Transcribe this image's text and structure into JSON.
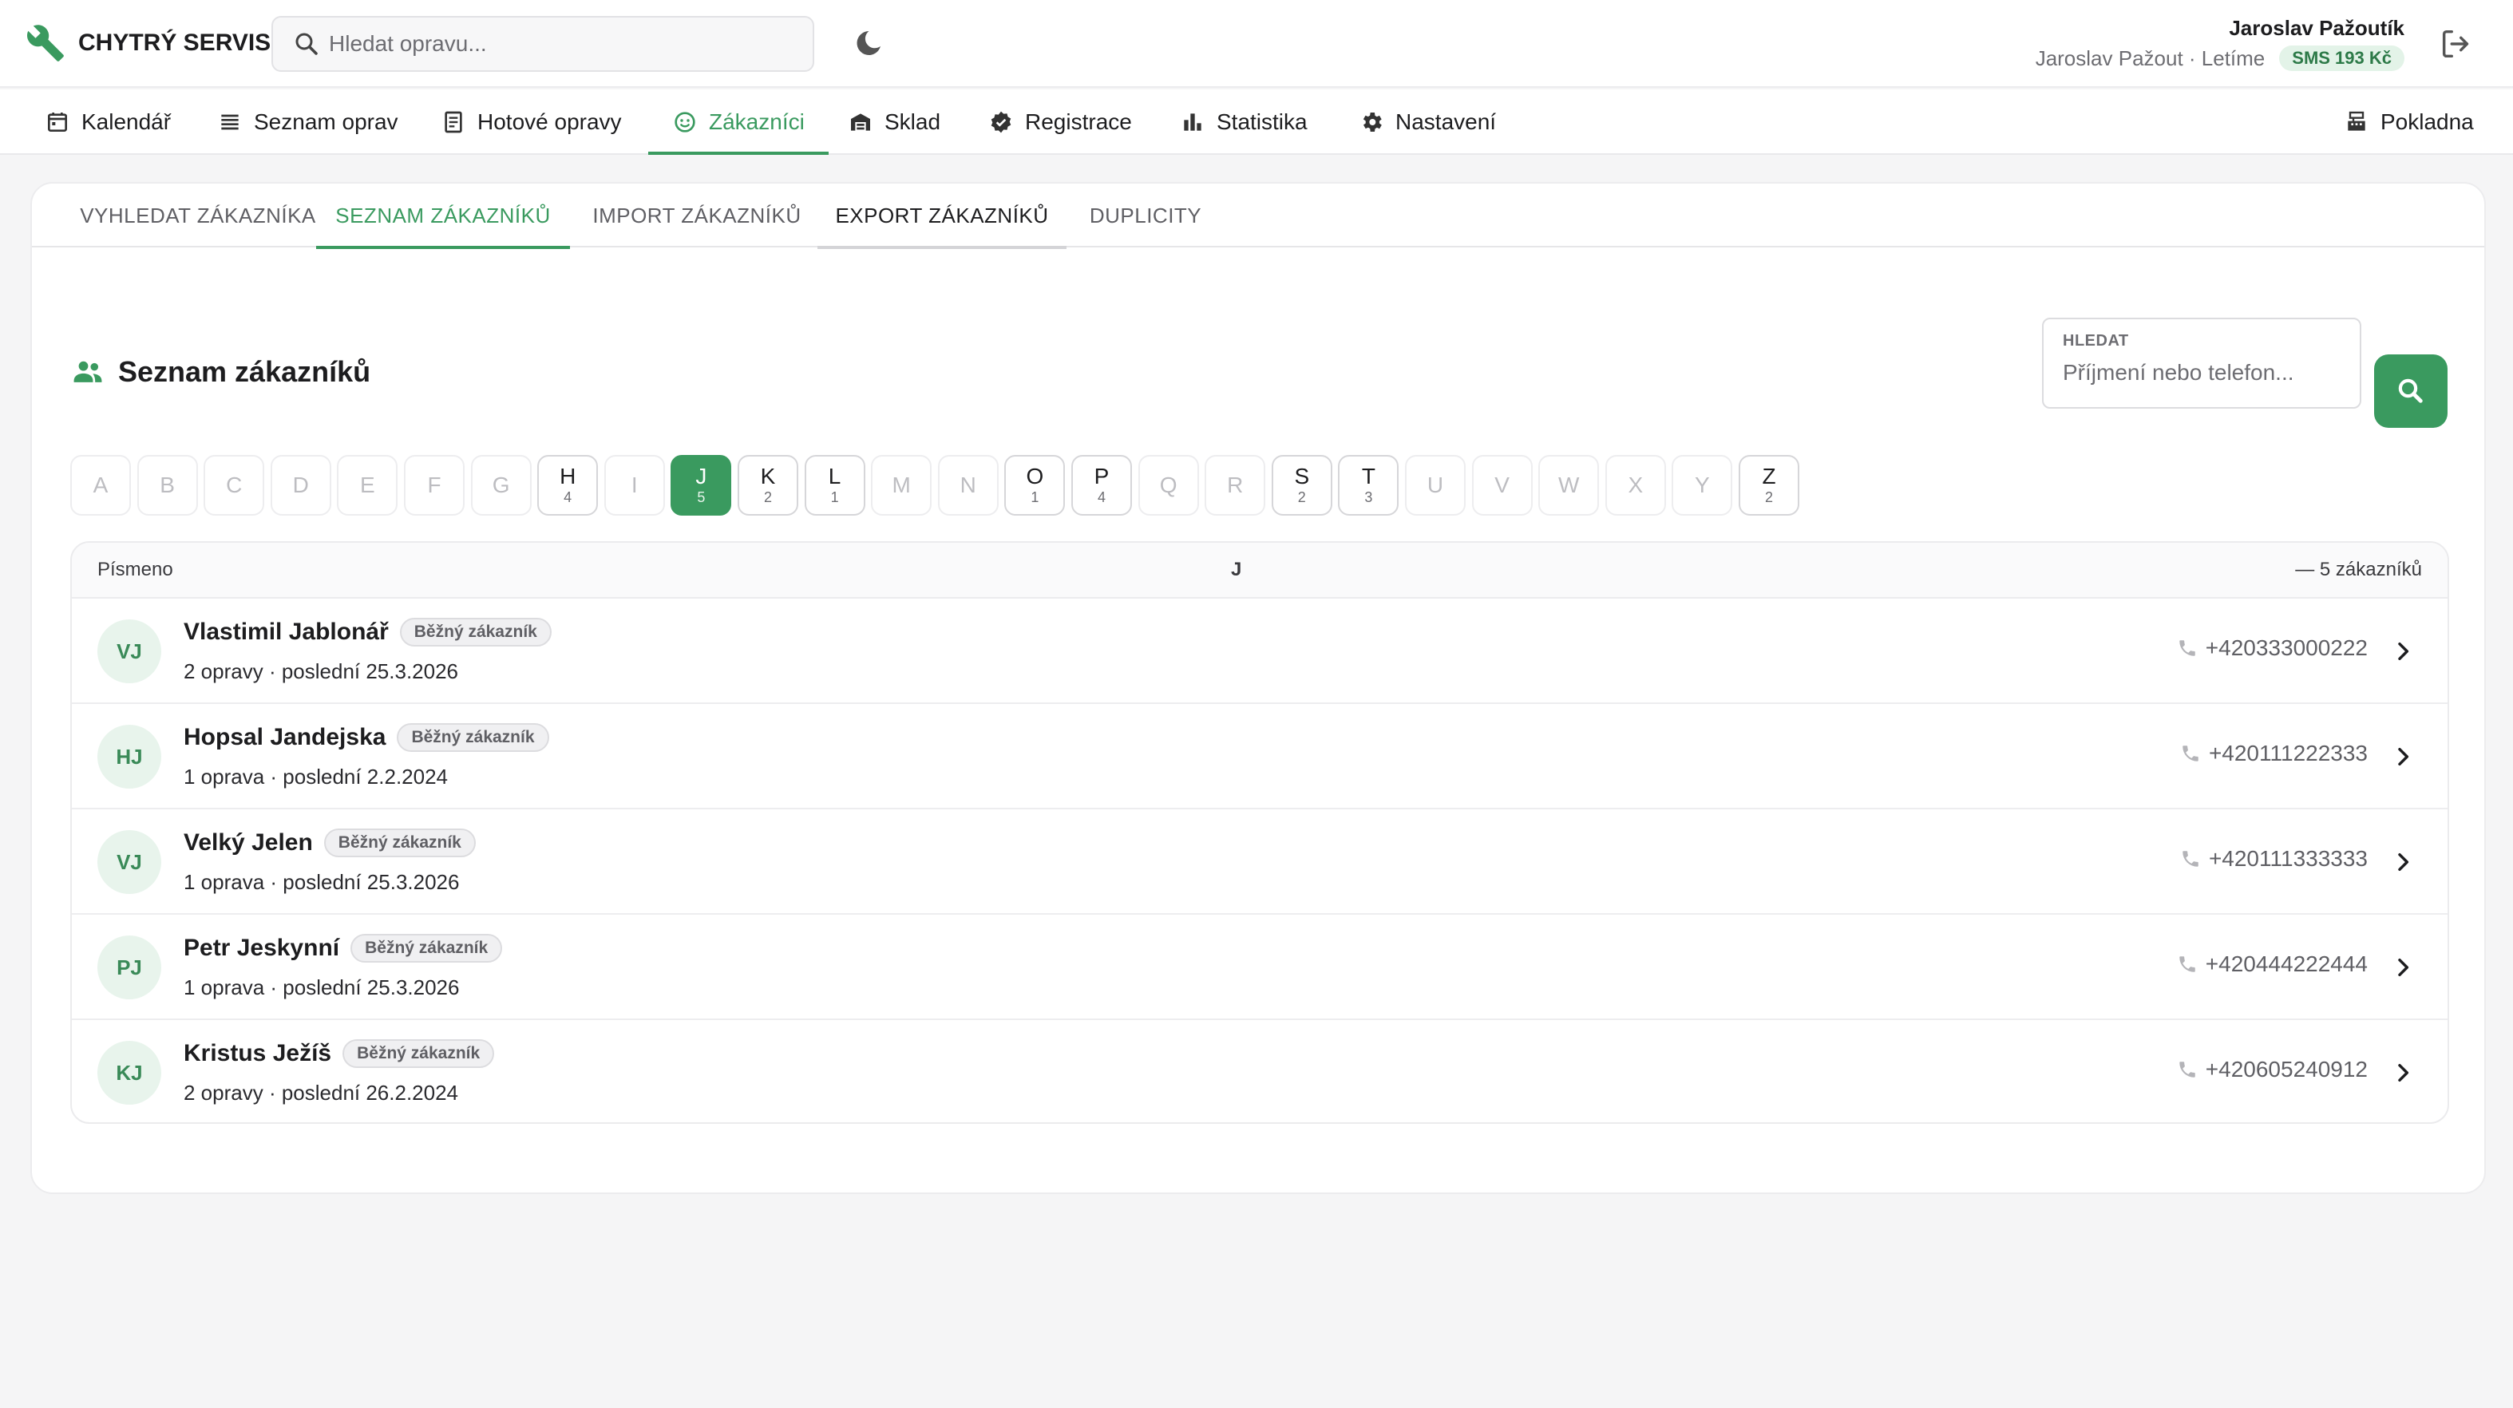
{
  "app": {
    "brand": "CHYTRÝ SERVIS",
    "search_placeholder": "Hledat opravu..."
  },
  "user": {
    "name": "Jaroslav Pažoutík",
    "sub": "Jaroslav Pažout · Letíme",
    "sms": "SMS 193 Kč"
  },
  "nav": {
    "items": [
      {
        "label": "Kalendář",
        "icon": "calendar-icon"
      },
      {
        "label": "Seznam oprav",
        "icon": "list-icon"
      },
      {
        "label": "Hotové opravy",
        "icon": "document-icon"
      },
      {
        "label": "Zákazníci",
        "icon": "smile-icon",
        "active": true
      },
      {
        "label": "Sklad",
        "icon": "warehouse-icon"
      },
      {
        "label": "Registrace",
        "icon": "verified-icon"
      },
      {
        "label": "Statistika",
        "icon": "bar-chart-icon"
      },
      {
        "label": "Nastavení",
        "icon": "gear-icon"
      }
    ],
    "cash": "Pokladna"
  },
  "subtabs": [
    "VYHLEDAT ZÁKAZNÍKA",
    "SEZNAM ZÁKAZNÍKŮ",
    "IMPORT ZÁKAZNÍKŮ",
    "EXPORT ZÁKAZNÍKŮ",
    "DUPLICITY"
  ],
  "active_subtab": "SEZNAM ZÁKAZNÍKŮ",
  "section_title": "Seznam zákazníků",
  "find": {
    "label": "HLEDAT",
    "placeholder": "Příjmení nebo telefon..."
  },
  "letters": [
    {
      "ch": "A",
      "n": ""
    },
    {
      "ch": "B",
      "n": ""
    },
    {
      "ch": "C",
      "n": ""
    },
    {
      "ch": "D",
      "n": ""
    },
    {
      "ch": "E",
      "n": ""
    },
    {
      "ch": "F",
      "n": ""
    },
    {
      "ch": "G",
      "n": ""
    },
    {
      "ch": "H",
      "n": "4"
    },
    {
      "ch": "I",
      "n": ""
    },
    {
      "ch": "J",
      "n": "5",
      "selected": true
    },
    {
      "ch": "K",
      "n": "2"
    },
    {
      "ch": "L",
      "n": "1"
    },
    {
      "ch": "M",
      "n": ""
    },
    {
      "ch": "N",
      "n": ""
    },
    {
      "ch": "O",
      "n": "1"
    },
    {
      "ch": "P",
      "n": "4"
    },
    {
      "ch": "Q",
      "n": ""
    },
    {
      "ch": "R",
      "n": ""
    },
    {
      "ch": "S",
      "n": "2"
    },
    {
      "ch": "T",
      "n": "3"
    },
    {
      "ch": "U",
      "n": ""
    },
    {
      "ch": "V",
      "n": ""
    },
    {
      "ch": "W",
      "n": ""
    },
    {
      "ch": "X",
      "n": ""
    },
    {
      "ch": "Y",
      "n": ""
    },
    {
      "ch": "Z",
      "n": "2"
    }
  ],
  "list_head": {
    "left": "Písmeno",
    "letter": "J",
    "count": "— 5 zákazníků"
  },
  "customers": [
    {
      "initials": "VJ",
      "name": "Vlastimil Jablonář",
      "tag": "Běžný zákazník",
      "meta": "2 opravy  ·  poslední 25.3.2026",
      "phone": "+420333000222"
    },
    {
      "initials": "HJ",
      "name": "Hopsal Jandejska",
      "tag": "Běžný zákazník",
      "meta": "1 oprava  ·  poslední 2.2.2024",
      "phone": "+420111222333"
    },
    {
      "initials": "VJ",
      "name": "Velký Jelen",
      "tag": "Běžný zákazník",
      "meta": "1 oprava  ·  poslední 25.3.2026",
      "phone": "+420111333333"
    },
    {
      "initials": "PJ",
      "name": "Petr Jeskynní",
      "tag": "Běžný zákazník",
      "meta": "1 oprava  ·  poslední 25.3.2026",
      "phone": "+420444222444"
    },
    {
      "initials": "KJ",
      "name": "Kristus Ježíš",
      "tag": "Běžný zákazník",
      "meta": "2 opravy  ·  poslední 26.2.2024",
      "phone": "+420605240912"
    }
  ],
  "colors": {
    "accent": "#3a9a5f",
    "avatar_bg": "#e8f4ec",
    "sms_bg": "#e3f3e8"
  }
}
